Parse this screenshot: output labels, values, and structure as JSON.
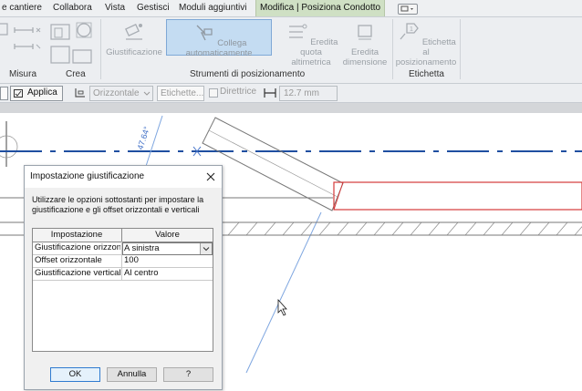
{
  "tabs": [
    {
      "label": "e cantiere"
    },
    {
      "label": "Collabora"
    },
    {
      "label": "Vista"
    },
    {
      "label": "Gestisci"
    },
    {
      "label": "Moduli aggiuntivi"
    },
    {
      "label": "Modifica | Posiziona Condotto"
    }
  ],
  "ribbon": {
    "panels": {
      "measure": "Misura",
      "create": "Crea",
      "positioning_tools": "Strumenti di posizionamento",
      "tag": "Etichetta"
    },
    "buttons": {
      "justification": "Giustificazione",
      "auto_connect": "Collega automaticamente",
      "inherit_elevation": "Eredita quota altimetrica",
      "inherit_size": "Eredita dimensione",
      "tag_on_placement": "Etichetta al posizionamento"
    }
  },
  "options_bar": {
    "apply": "Applica",
    "orientation": "Orizzontale",
    "tag_placeholder": "Etichette...",
    "leader": "Direttrice",
    "length": "12.7 mm"
  },
  "drawing": {
    "angle_label": "47.64°"
  },
  "dialog": {
    "title": "Impostazione giustificazione",
    "description": "Utilizzare le opzioni sottostanti per impostare la giustificazione e gli offset orizzontali e verticali",
    "table": {
      "headers": [
        "Impostazione",
        "Valore"
      ],
      "rows": [
        {
          "setting": "Giustificazione orizzontale",
          "value": "A sinistra"
        },
        {
          "setting": "Offset orizzontale",
          "value": "100"
        },
        {
          "setting": "Giustificazione verticale",
          "value": "Al centro"
        }
      ]
    },
    "buttons": {
      "ok": "OK",
      "cancel": "Annulla",
      "help": "?"
    }
  }
}
